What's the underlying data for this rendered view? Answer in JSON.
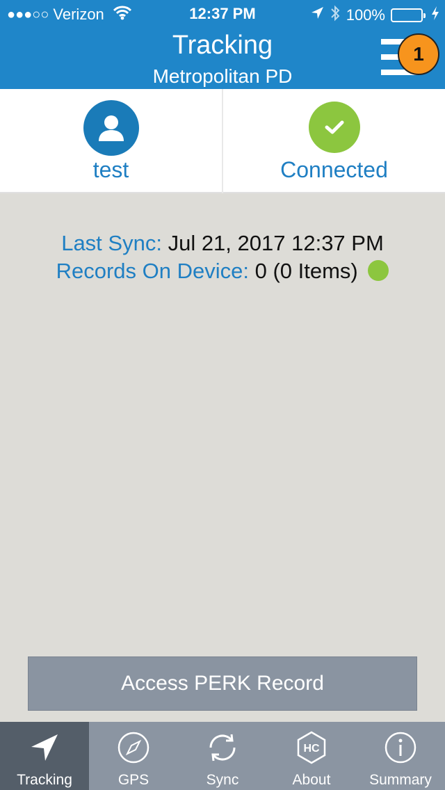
{
  "status_bar": {
    "signal_dots": "●●●○○",
    "carrier": "Verizon",
    "time": "12:37 PM",
    "battery_percent": "100%",
    "battery_level": 1.0
  },
  "header": {
    "title": "Tracking",
    "subtitle": "Metropolitan PD",
    "menu_icon": "hamburger-menu-icon",
    "badge": "1",
    "colors": {
      "background": "#1f86c9",
      "badge": "#f7941d"
    }
  },
  "cards": [
    {
      "icon": "user-icon",
      "label": "test",
      "color": "#1a7bb8"
    },
    {
      "icon": "check-icon",
      "label": "Connected",
      "color": "#8cc63f"
    }
  ],
  "sync": {
    "last_sync_label": "Last Sync:",
    "last_sync_value": "Jul 21, 2017 12:37 PM",
    "records_label": "Records On Device:",
    "records_value": "0 (0 Items)",
    "status_color": "#8cc63f"
  },
  "access_button": {
    "label": "Access PERK Record"
  },
  "tabs": [
    {
      "icon": "navigation-arrow-icon",
      "label": "Tracking",
      "active": true
    },
    {
      "icon": "compass-icon",
      "label": "GPS",
      "active": false
    },
    {
      "icon": "sync-icon",
      "label": "Sync",
      "active": false
    },
    {
      "icon": "hc-hexagon-icon",
      "label": "About",
      "active": false
    },
    {
      "icon": "info-icon",
      "label": "Summary",
      "active": false
    }
  ]
}
